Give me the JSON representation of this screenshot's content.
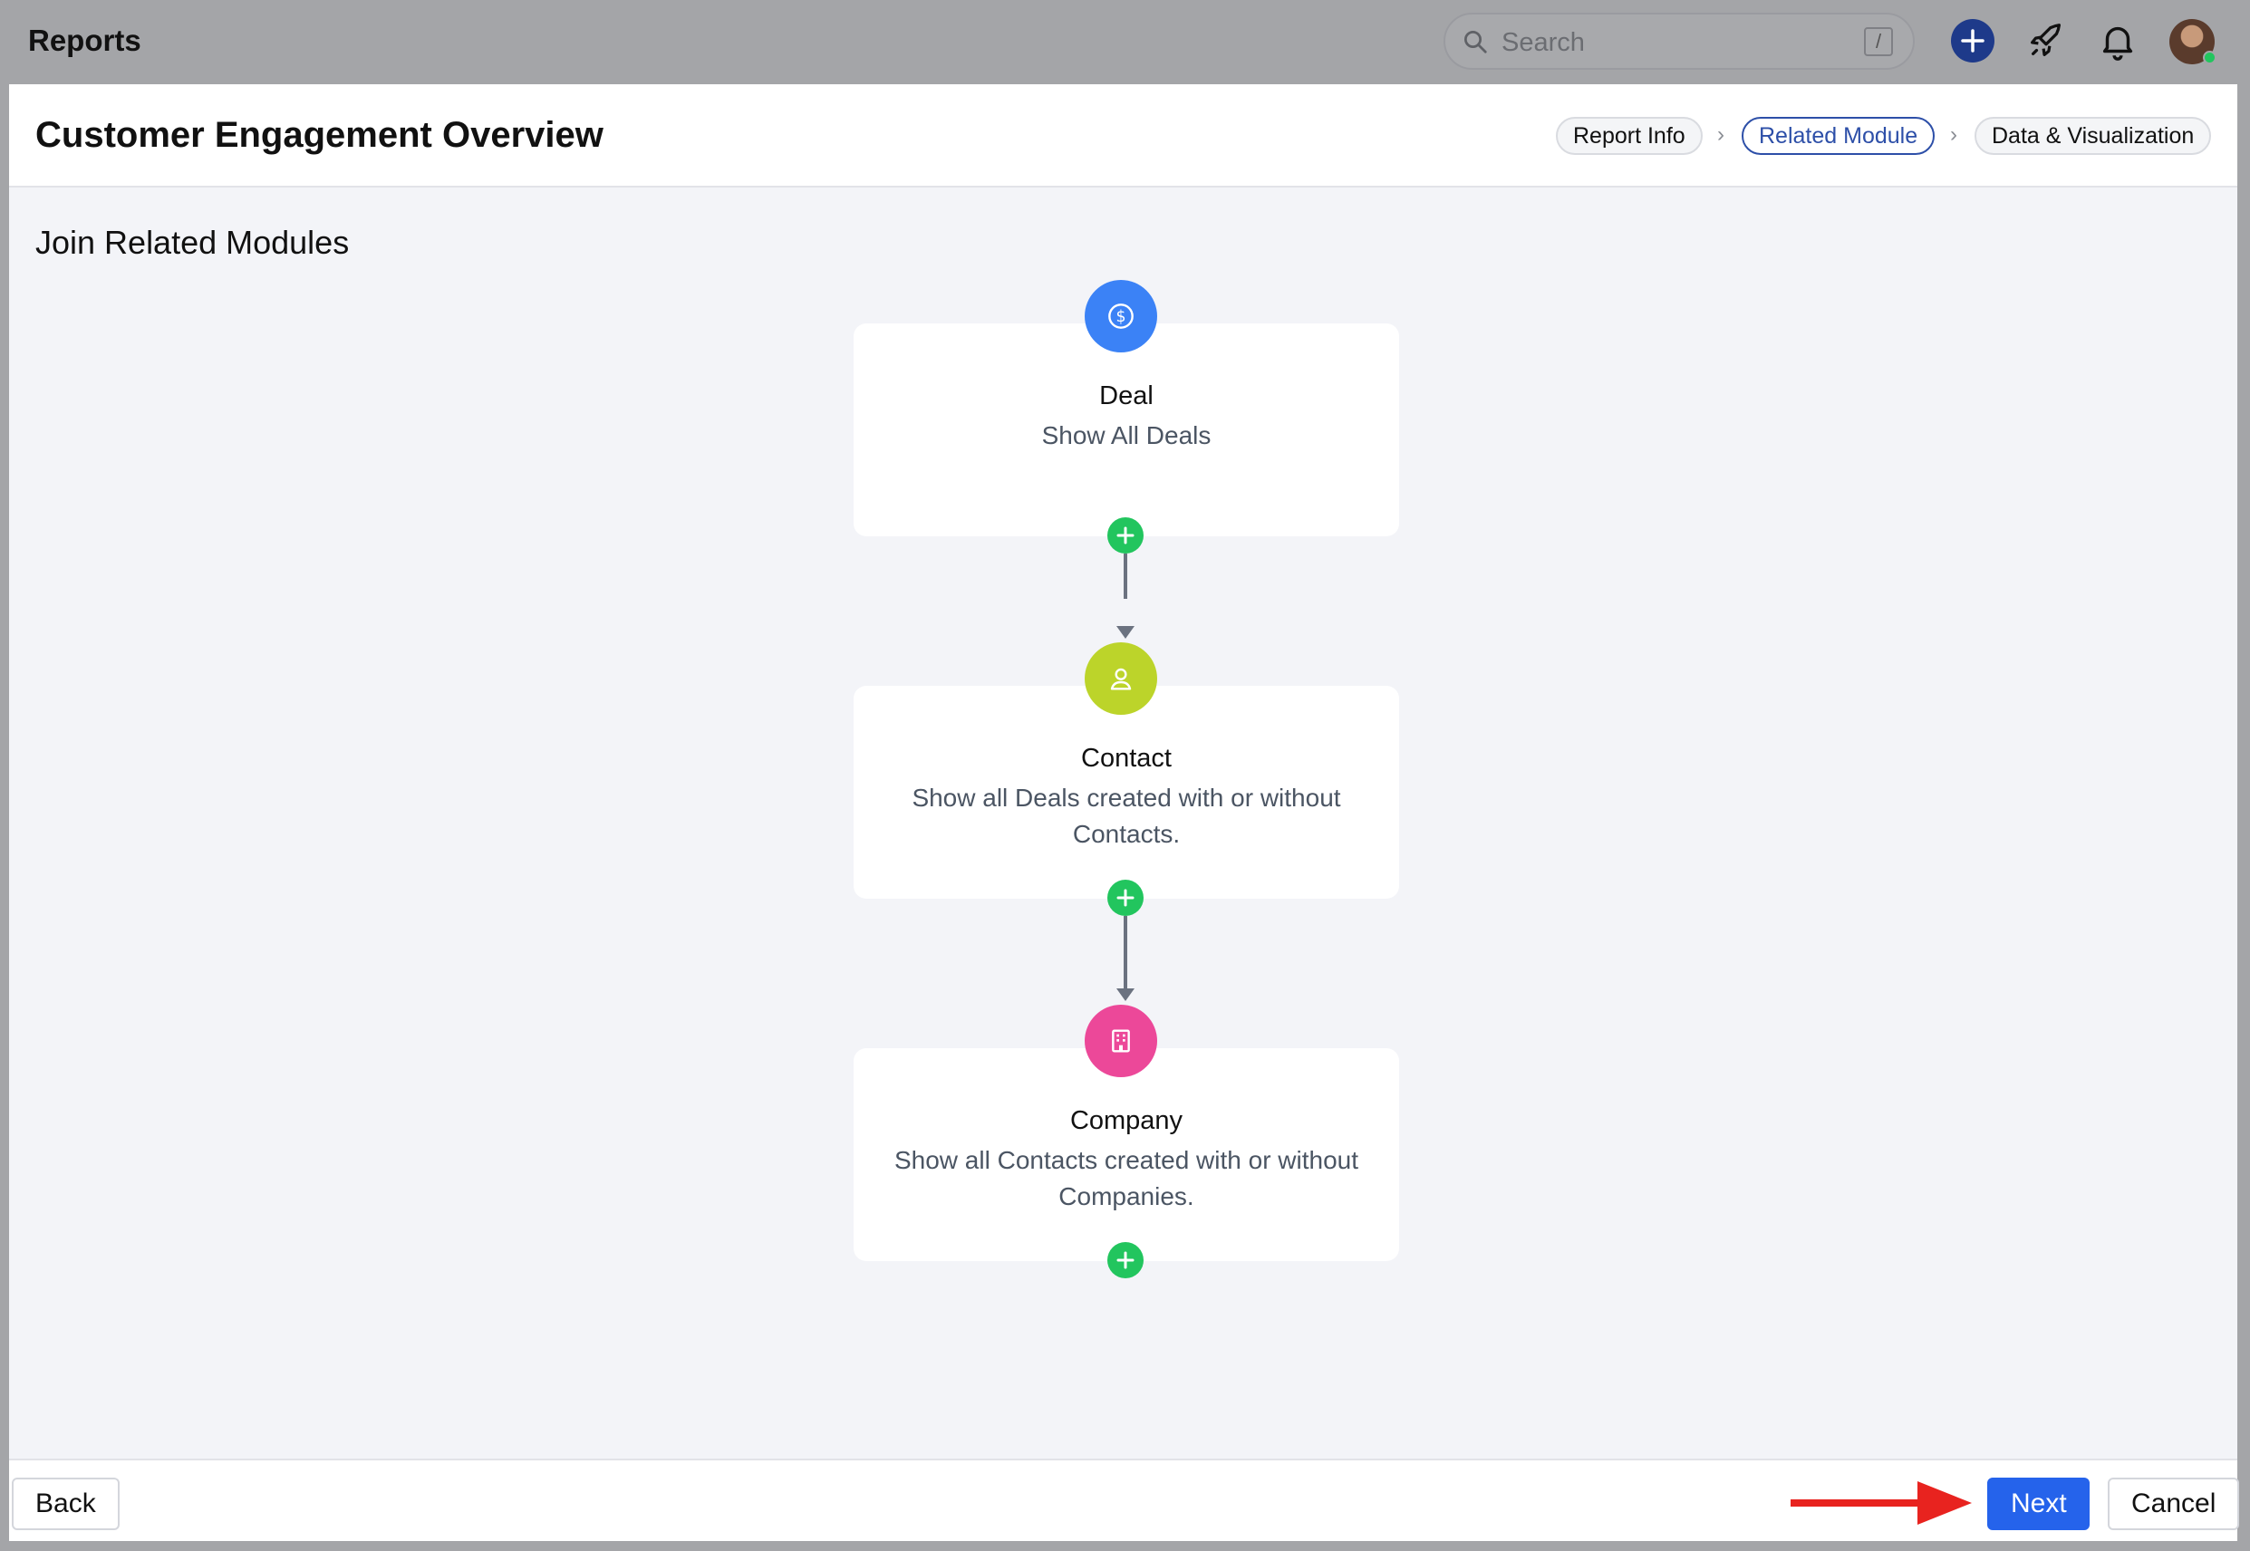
{
  "topbar": {
    "app_title": "Reports",
    "search": {
      "placeholder": "Search",
      "shortcut": "/"
    },
    "icons": [
      "plus-icon",
      "rocket-icon",
      "bell-icon",
      "avatar"
    ]
  },
  "page": {
    "title": "Customer Engagement Overview",
    "steps": [
      {
        "label": "Report Info",
        "active": false
      },
      {
        "label": "Related Module",
        "active": true
      },
      {
        "label": "Data & Visualization",
        "active": false
      }
    ],
    "section_title": "Join Related Modules"
  },
  "modules": [
    {
      "name": "Deal",
      "description": "Show All Deals",
      "icon": "dollar-icon",
      "color": "#3b82f6"
    },
    {
      "name": "Contact",
      "description": "Show all Deals created with or without Contacts.",
      "icon": "person-icon",
      "color": "#bcd42a"
    },
    {
      "name": "Company",
      "description": "Show all Contacts created with or without Companies.",
      "icon": "building-icon",
      "color": "#ec4899"
    }
  ],
  "footer": {
    "back_label": "Back",
    "next_label": "Next",
    "cancel_label": "Cancel"
  },
  "colors": {
    "accent": "#2563eb",
    "add_green": "#22c55e",
    "annotation_red": "#e8231f"
  }
}
